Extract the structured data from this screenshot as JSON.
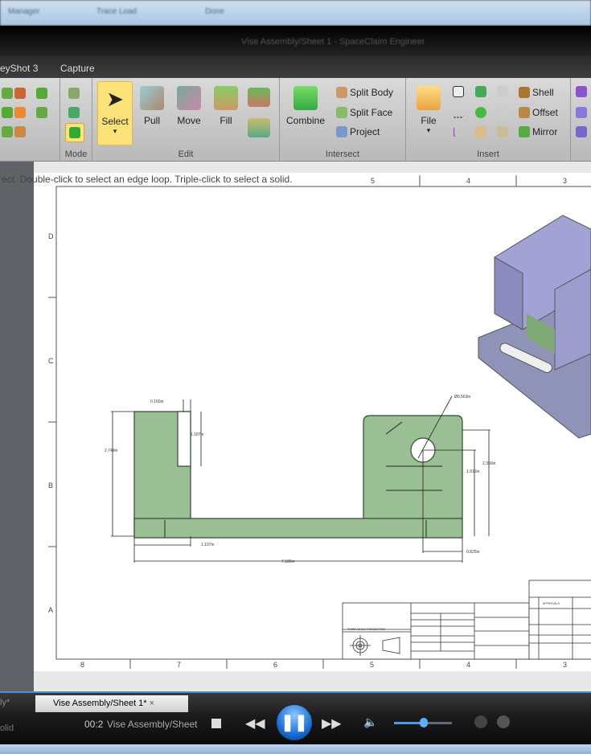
{
  "window": {
    "title": "Vise Assembly/Sheet 1 - SpaceClaim Engineer"
  },
  "taskbar": {
    "items": [
      "Manager",
      "Trace Load",
      "Done"
    ]
  },
  "menu_tabs": [
    "eyShot 3",
    "Capture"
  ],
  "ribbon": {
    "mode": {
      "label": "Mode"
    },
    "edit": {
      "label": "Edit",
      "buttons": [
        "Select",
        "Pull",
        "Move",
        "Fill"
      ]
    },
    "intersect": {
      "label": "Intersect",
      "combine": "Combine",
      "split_body": "Split Body",
      "split_face": "Split Face",
      "project": "Project"
    },
    "insert": {
      "label": "Insert",
      "file": "File",
      "shell": "Shell",
      "offset": "Offset",
      "mirror": "Mirror"
    }
  },
  "hint": "ect. Double-click to select an edge loop. Triple-click to select a solid.",
  "drawing": {
    "col_labels_top": [
      "5",
      "4",
      "3"
    ],
    "col_labels_bottom": [
      "8",
      "7",
      "6",
      "5",
      "4",
      "3"
    ],
    "row_labels": [
      "D",
      "C",
      "B",
      "A"
    ],
    "dimensions": {
      "d1": "0.160in",
      "d2": "1.187in",
      "d3": "2.749in",
      "d4": "Ø0.563in",
      "d5": "1.915in",
      "d6": "2.350in",
      "d7": "1.197in",
      "d8": "0.825in",
      "d9": "7.186in"
    },
    "title_block": {
      "projection": "THIRD ANGLE PROJECTION",
      "approvals": "APPROVALS"
    }
  },
  "doc_tabs": {
    "prev": "ly*",
    "active": "Vise Assembly/Sheet 1*"
  },
  "left_status": "olid",
  "player": {
    "time": "00:2",
    "media_title": "Vise Assembly/Sheet",
    "volume_fraction": 0.5,
    "state": "playing"
  },
  "colors": {
    "part_green": "#9bbf95",
    "model_lavender": "#9a9ac8",
    "select_highlight": "#fde27a",
    "player_blue": "#1a6fd6"
  }
}
